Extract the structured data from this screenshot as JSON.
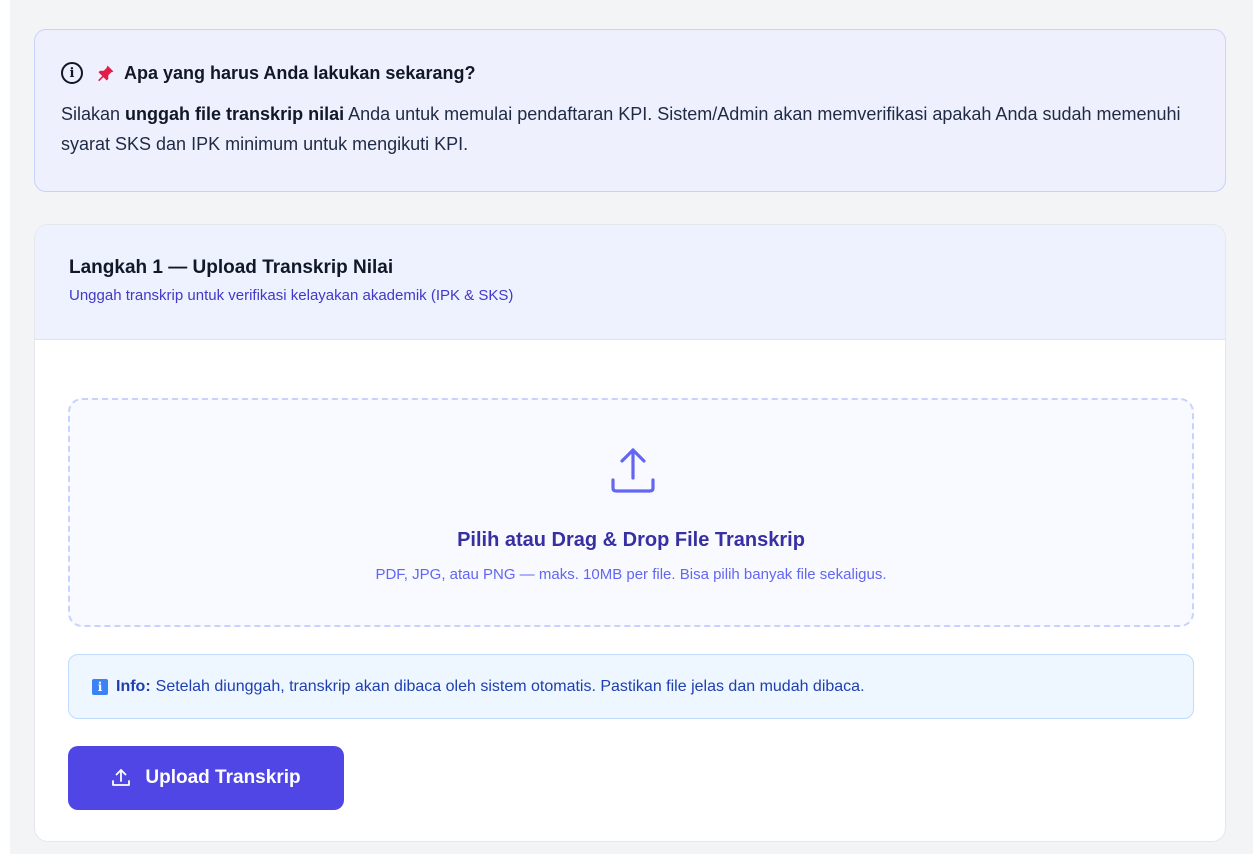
{
  "alert": {
    "title": "Apa yang harus Anda lakukan sekarang?",
    "body_prefix": "Silakan ",
    "body_bold": "unggah file transkrip nilai",
    "body_suffix": " Anda untuk memulai pendaftaran KPI. Sistem/Admin akan memverifikasi apakah Anda sudah memenuhi syarat SKS dan IPK minimum untuk mengikuti KPI.",
    "icons": [
      "info-circle-icon",
      "pushpin-icon"
    ]
  },
  "card": {
    "title": "Langkah 1 — Upload Transkrip Nilai",
    "subtitle": "Unggah transkrip untuk verifikasi kelayakan akademik (IPK & SKS)"
  },
  "dropzone": {
    "icon": "upload-icon",
    "title": "Pilih atau Drag & Drop File Transkrip",
    "subtitle": "PDF, JPG, atau PNG — maks. 10MB per file. Bisa pilih banyak file sekaligus."
  },
  "info_note": {
    "icon": "info-square-icon",
    "label": "Info:",
    "text": "Setelah diunggah, transkrip akan dibaca oleh sistem otomatis. Pastikan file jelas dan mudah dibaca."
  },
  "upload_button": {
    "icon": "upload-icon",
    "label": "Upload Transkrip"
  },
  "colors": {
    "accent": "#4f46e5",
    "alert_bg": "#eef0fd",
    "info_bg": "#eef6ff",
    "pin": "#e11d48"
  }
}
